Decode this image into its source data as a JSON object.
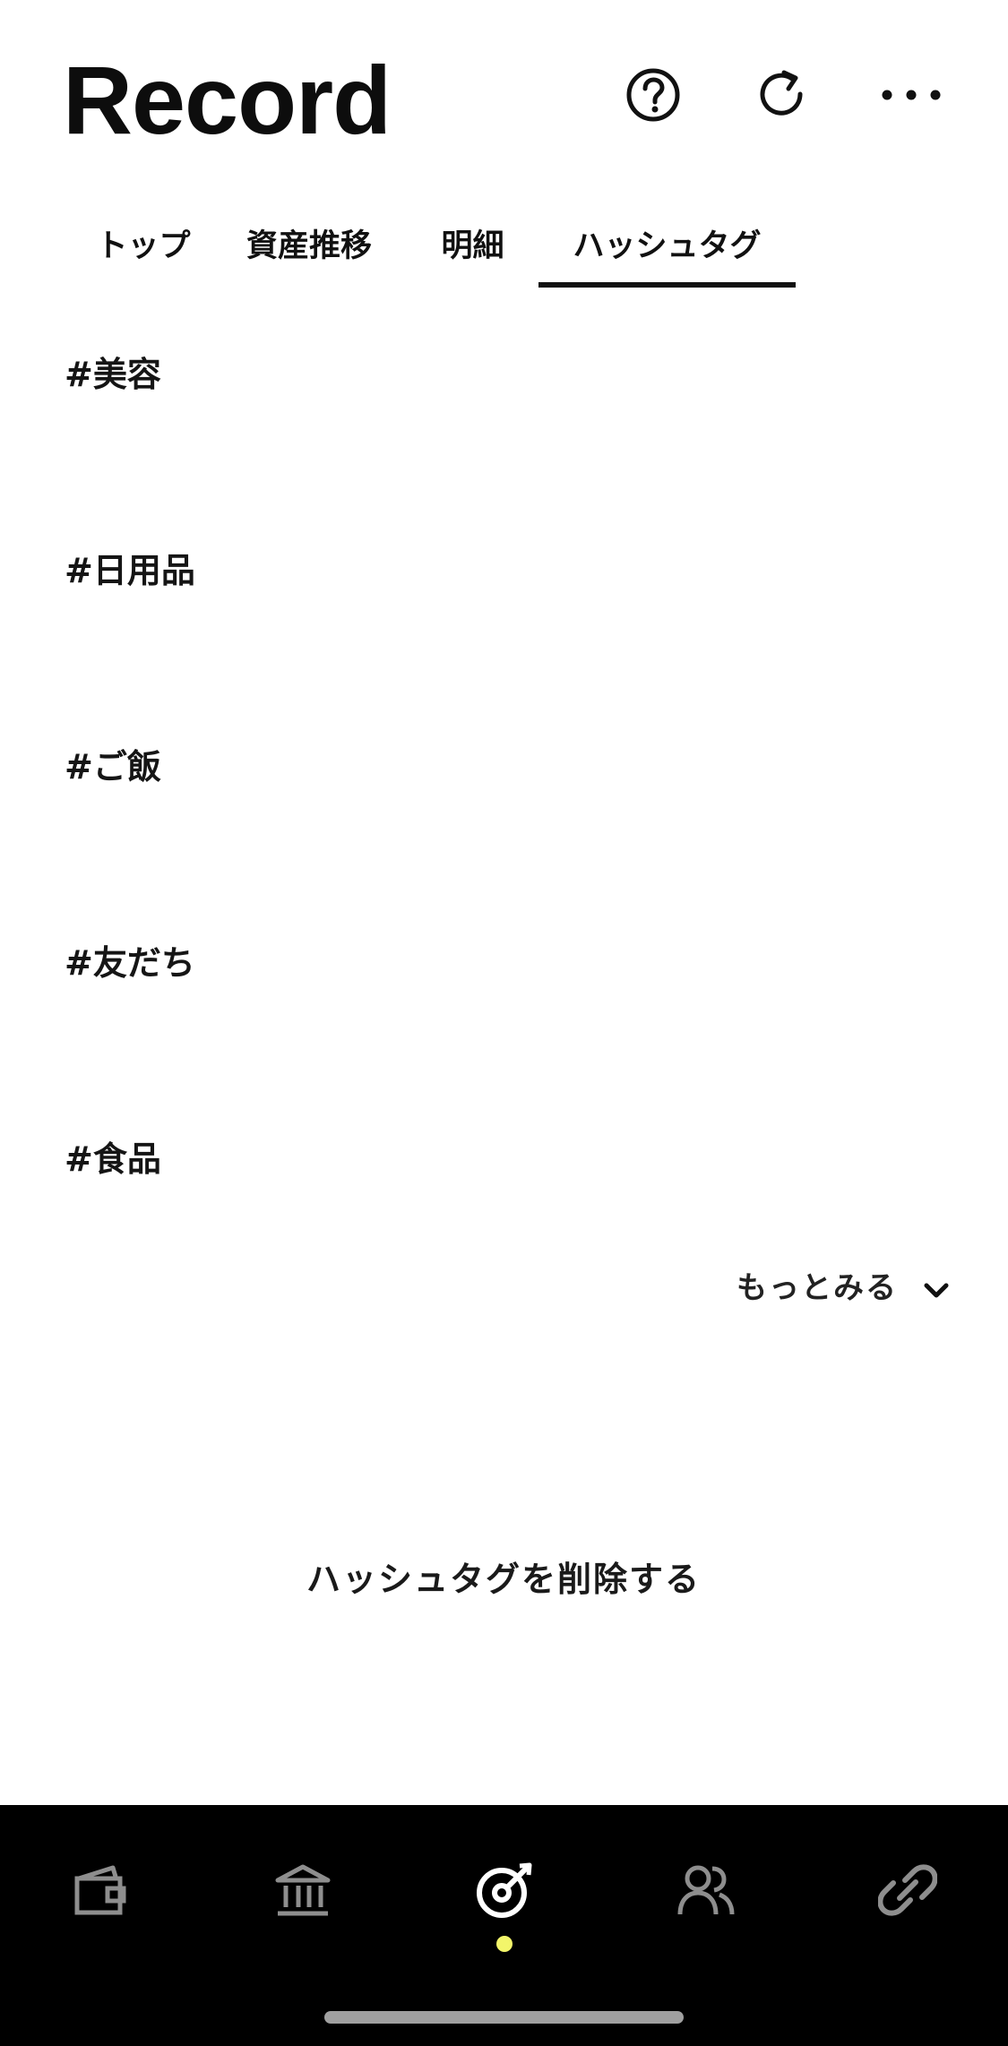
{
  "header": {
    "title": "Record",
    "actions": [
      {
        "name": "help",
        "icon": "help-circle-icon"
      },
      {
        "name": "refresh",
        "icon": "refresh-icon"
      },
      {
        "name": "more",
        "icon": "more-horizontal-icon"
      }
    ]
  },
  "tabs": [
    {
      "label": "トップ",
      "selected": false
    },
    {
      "label": "資産推移",
      "selected": false
    },
    {
      "label": "明細",
      "selected": false
    },
    {
      "label": "ハッシュタグ",
      "selected": true
    }
  ],
  "hashtags": [
    {
      "label": "#美容"
    },
    {
      "label": "#日用品"
    },
    {
      "label": "#ご飯"
    },
    {
      "label": "#友だち"
    },
    {
      "label": "#食品"
    }
  ],
  "more": {
    "label": "もっとみる",
    "icon": "chevron-down-icon"
  },
  "delete_action": {
    "label": "ハッシュタグを削除する"
  },
  "bottom_nav": {
    "items": [
      {
        "icon": "wallet-icon",
        "active": false
      },
      {
        "icon": "bank-icon",
        "active": false
      },
      {
        "icon": "record-target-icon",
        "active": true
      },
      {
        "icon": "people-icon",
        "active": false
      },
      {
        "icon": "link-icon",
        "active": false
      }
    ],
    "active_indicator_color": "#f3f56a",
    "inactive_icon_color": "#8e8e8e",
    "active_icon_color": "#ffffff"
  },
  "colors": {
    "background": "#ffffff",
    "text": "#111111",
    "nav_background": "#000000"
  }
}
